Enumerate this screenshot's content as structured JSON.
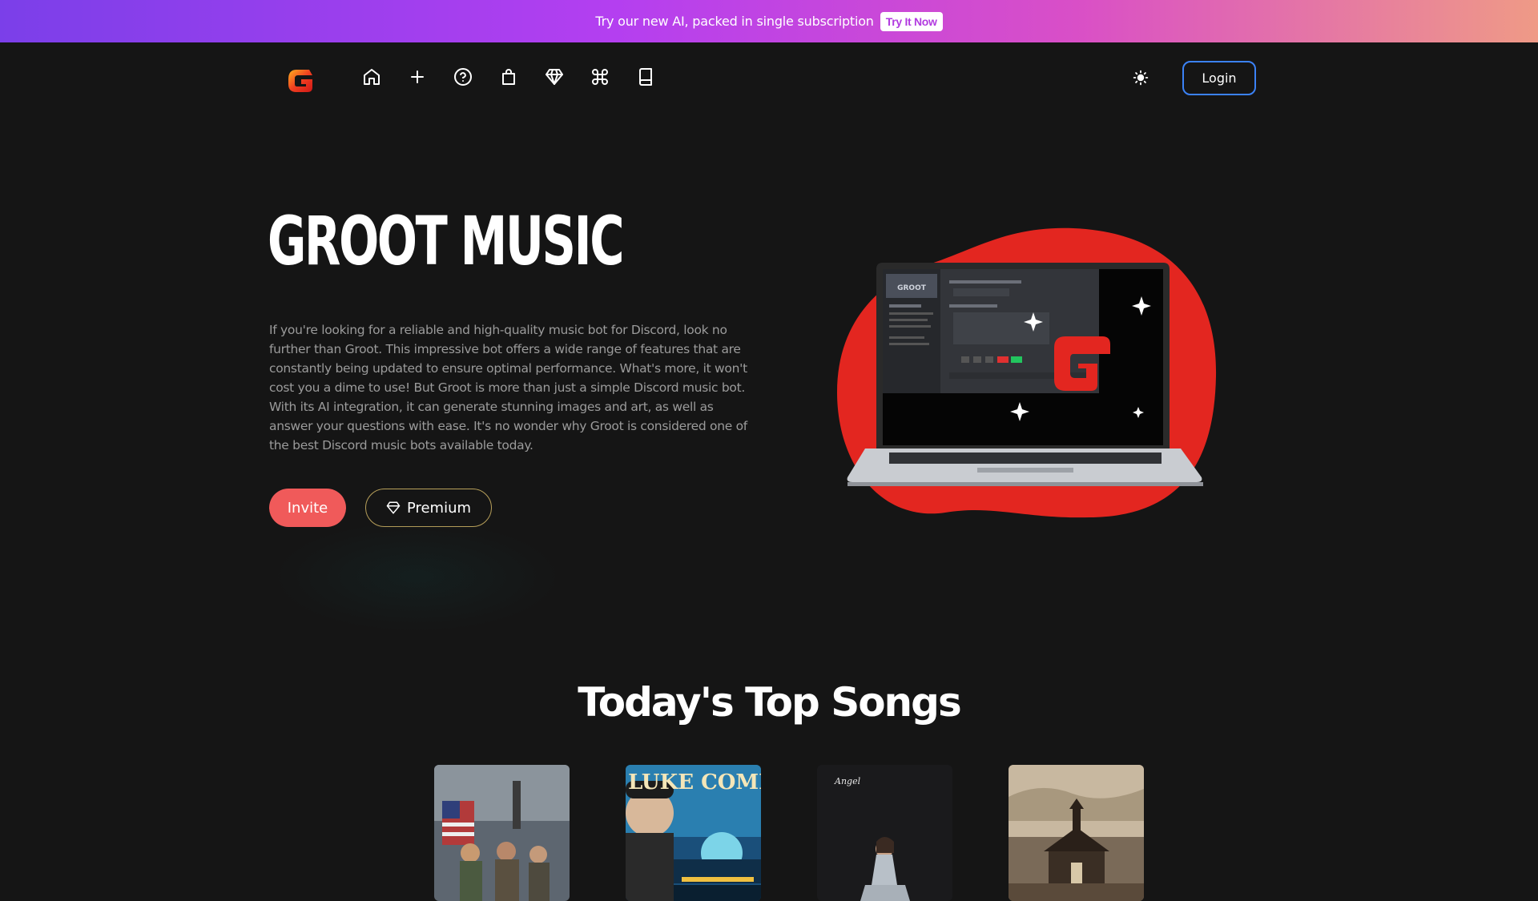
{
  "promo": {
    "text": "Try our new AI, packed in single subscription",
    "button": "Try It Now"
  },
  "nav": {
    "icons": [
      "home-icon",
      "plus-icon",
      "help-circle-icon",
      "shopping-bag-icon",
      "diamond-icon",
      "command-icon",
      "book-icon"
    ],
    "login": "Login"
  },
  "hero": {
    "title": "GROOT MUSIC",
    "description": "If you're looking for a reliable and high-quality music bot for Discord, look no further than Groot. This impressive bot offers a wide range of features that are constantly being updated to ensure optimal performance. What's more, it won't cost you a dime to use! But Groot is more than just a simple Discord music bot. With its AI integration, it can generate stunning images and art, as well as answer your questions with ease. It's no wonder why Groot is considered one of the best Discord music bots available today.",
    "invite": "Invite",
    "premium": "Premium"
  },
  "laptop_screen": {
    "server_name": "GROOT"
  },
  "songs_section": {
    "title": "Today's Top Songs",
    "albums": [
      {
        "cover": "flag-soldiers-album-cover"
      },
      {
        "cover": "luke-combs-album-cover",
        "cover_text": "LUKE COMBS"
      },
      {
        "cover": "angel-album-cover",
        "cover_text": "Angel"
      },
      {
        "cover": "chapel-album-cover"
      }
    ]
  },
  "colors": {
    "background": "#151515",
    "accent_red": "#f05a5a",
    "login_border": "#3b82f6",
    "premium_border": "#b8a05a"
  }
}
